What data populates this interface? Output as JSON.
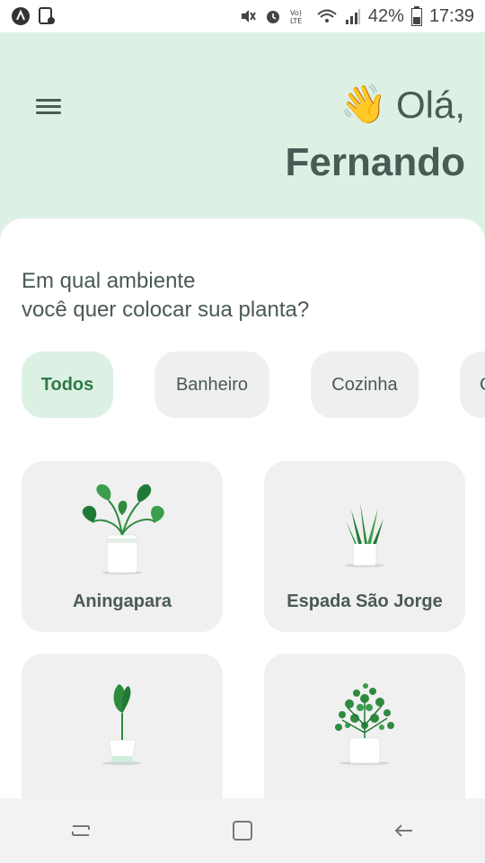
{
  "status_bar": {
    "battery": "42%",
    "time": "17:39",
    "left_icons": [
      "app-icon",
      "notification-icon"
    ],
    "right_icons": [
      "mute-icon",
      "alarm-icon",
      "volte-icon",
      "wifi-icon",
      "signal-icon",
      "battery-icon"
    ]
  },
  "header": {
    "greeting": "Olá,",
    "wave_emoji": "👋",
    "user_name": "Fernando"
  },
  "main": {
    "question_line1": "Em qual ambiente",
    "question_line2": "você quer colocar sua planta?",
    "environments": [
      {
        "label": "Todos",
        "active": true
      },
      {
        "label": "Banheiro",
        "active": false
      },
      {
        "label": "Cozinha",
        "active": false
      },
      {
        "label": "C",
        "active": false
      }
    ],
    "plants": [
      {
        "name": "Aningapara",
        "icon": "aningapara-plant-icon"
      },
      {
        "name": "Espada São Jorge",
        "icon": "espada-sao-jorge-plant-icon"
      },
      {
        "name": "",
        "icon": "tall-leaf-plant-icon"
      },
      {
        "name": "",
        "icon": "bushy-plant-icon"
      }
    ]
  },
  "nav_bar": {
    "buttons": [
      "recent-apps",
      "home",
      "back"
    ]
  },
  "colors": {
    "header_bg": "#dcf1e4",
    "accent_green": "#2f7a48",
    "text_dark": "#4a5a55",
    "card_bg": "#f0f0f0"
  }
}
